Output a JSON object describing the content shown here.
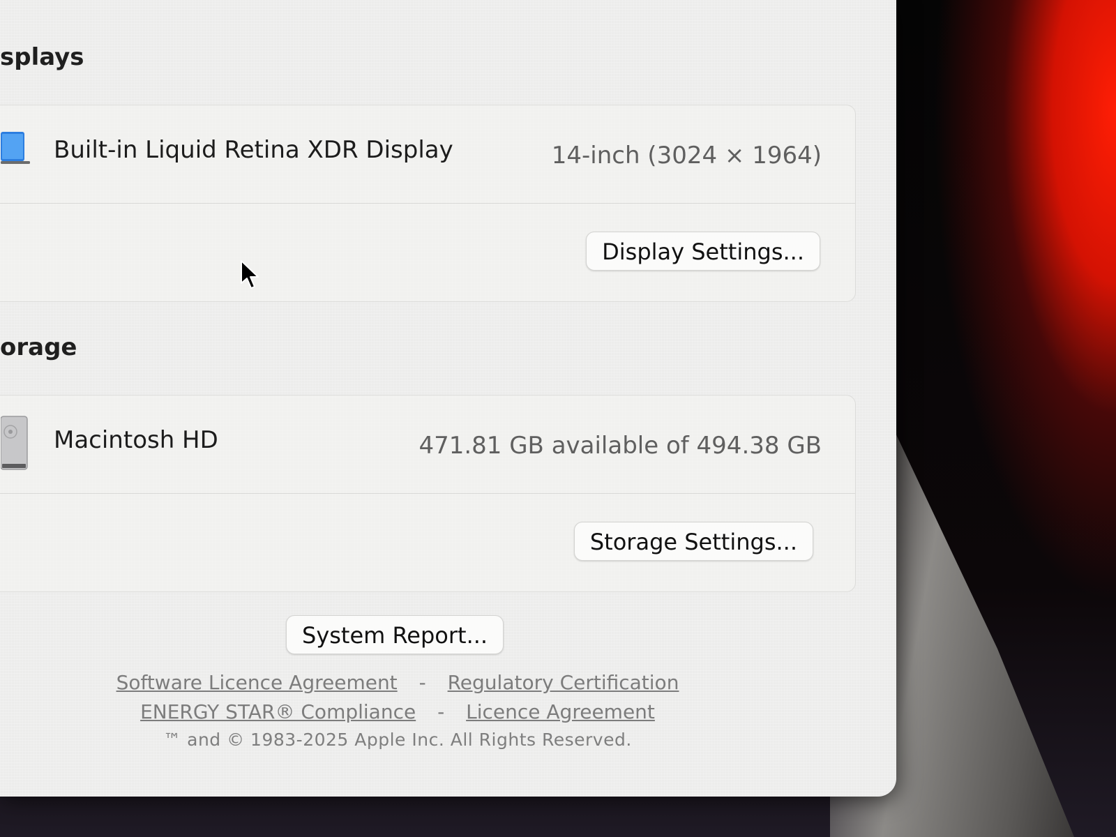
{
  "displays": {
    "title": "splays",
    "device_name": "Built-in Liquid Retina XDR Display",
    "device_detail": "14-inch (3024 × 1964)",
    "settings_button": "Display Settings..."
  },
  "storage": {
    "title": "orage",
    "device_name": "Macintosh HD",
    "device_detail": "471.81 GB available of 494.38 GB",
    "settings_button": "Storage Settings..."
  },
  "footer": {
    "system_report_button": "System Report...",
    "links_row_1": [
      "Software Licence Agreement",
      "Regulatory Certification"
    ],
    "links_row_2": [
      "ENERGY STAR® Compliance",
      "Licence Agreement"
    ],
    "separator": "-",
    "copyright": "™ and © 1983-2025 Apple Inc. All Rights Reserved."
  },
  "colors": {
    "window_background": "#ececeb",
    "link_text": "#7c7c7c",
    "backdrop_glow": "#ff1e05"
  },
  "icons": {
    "display": "laptop-display-icon",
    "storage": "hard-drive-icon",
    "pointer": "mouse-pointer-icon"
  }
}
